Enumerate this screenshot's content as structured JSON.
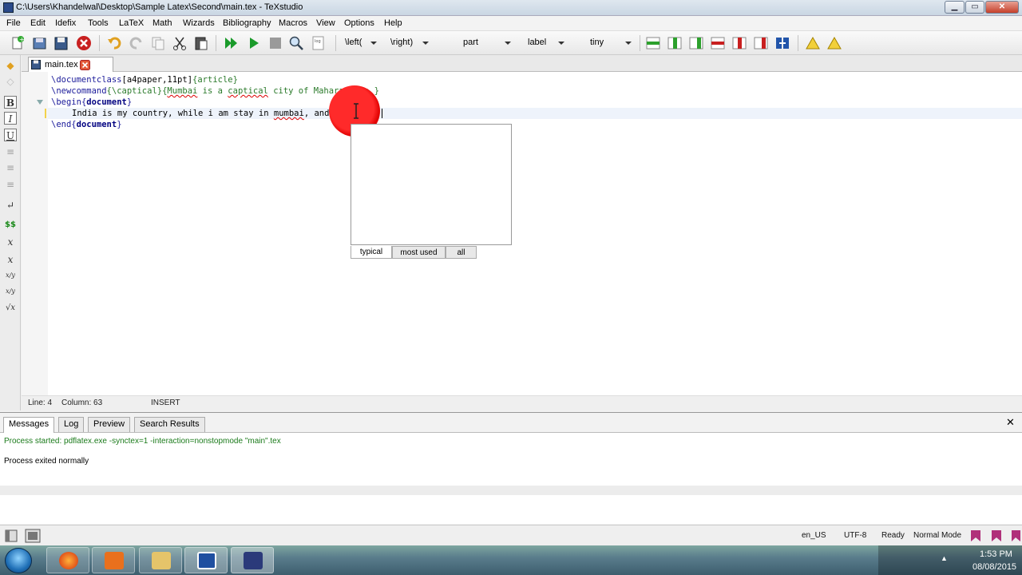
{
  "window": {
    "title": "C:\\Users\\Khandelwal\\Desktop\\Sample Latex\\Second\\main.tex - TeXstudio",
    "buttons": {
      "minimize": "▁",
      "maximize": "▭",
      "close": "✕"
    }
  },
  "menu": {
    "items": [
      "File",
      "Edit",
      "Idefix",
      "Tools",
      "LaTeX",
      "Math",
      "Wizards",
      "Bibliography",
      "Macros",
      "View",
      "Options",
      "Help"
    ]
  },
  "toolbar": {
    "combos": [
      {
        "label": "\\left("
      },
      {
        "label": "\\right)"
      },
      {
        "label": "part"
      },
      {
        "label": "label"
      },
      {
        "label": "tiny"
      }
    ],
    "icons": [
      "new-file-icon",
      "save-all-icon",
      "save-icon",
      "close-file-icon",
      "undo-icon",
      "redo-icon",
      "copy-icon",
      "cut-icon",
      "paste-icon",
      "build-and-view-icon",
      "compile-icon",
      "stop-icon",
      "view-pdf-icon",
      "view-log-icon"
    ]
  },
  "sidebar": {
    "items": [
      {
        "name": "bookmark-icon",
        "glyph": "◆"
      },
      {
        "name": "home-icon",
        "glyph": "◇"
      },
      {
        "name": "bold-icon",
        "glyph": "B"
      },
      {
        "name": "italic-icon",
        "glyph": "I"
      },
      {
        "name": "underline-icon",
        "glyph": "U"
      },
      {
        "name": "align-left-icon",
        "glyph": "≡"
      },
      {
        "name": "align-center-icon",
        "glyph": "≡"
      },
      {
        "name": "align-right-icon",
        "glyph": "≡"
      },
      {
        "name": "newline-icon",
        "glyph": "↵"
      },
      {
        "name": "math-mode-icon",
        "glyph": "$$"
      },
      {
        "name": "subscript-icon",
        "glyph": "x"
      },
      {
        "name": "superscript-icon",
        "glyph": "x"
      },
      {
        "name": "fraction-icon",
        "glyph": "x/y"
      },
      {
        "name": "dfrac-icon",
        "glyph": "x/y"
      },
      {
        "name": "sqrt-icon",
        "glyph": "√x"
      }
    ]
  },
  "editor": {
    "tab_label": "main.tex",
    "lines": {
      "l1_cmd": "\\documentclass",
      "l1_opt": "[a4paper,11pt]",
      "l1_arg": "{article}",
      "l2_cmd": "\\newcommand",
      "l2_arg1": "{\\captical}",
      "l2_open": "{",
      "l2_w1": "Mumbai",
      "l2_mid": " is a ",
      "l2_w2": "captical",
      "l2_rest": " city of Maharashtra }",
      "l3_cmd": "\\begin",
      "l3_open": "{",
      "l3_env": "document",
      "l3_close": "}",
      "l4_text1": "India is my country, while i am stay in ",
      "l4_w1": "mumbai",
      "l4_text2": ", and \\captical",
      "l5_cmd": "\\end",
      "l5_open": "{",
      "l5_env": "document",
      "l5_close": "}"
    }
  },
  "completer": {
    "tabs": [
      "typical",
      "most used",
      "all"
    ]
  },
  "status": {
    "line": "Line: 4",
    "column": "Column: 63",
    "mode": "INSERT"
  },
  "messages": {
    "tabs": [
      "Messages",
      "Log",
      "Preview",
      "Search Results"
    ],
    "close": "✕",
    "line1": "Process started: pdflatex.exe -synctex=1 -interaction=nonstopmode \"main\".tex",
    "line2": "Process exited normally"
  },
  "bottom": {
    "language": "en_US",
    "encoding": "UTF-8",
    "state": "Ready",
    "mode": "Normal Mode"
  },
  "taskbar": {
    "time": "1:53 PM",
    "date": "08/08/2015",
    "tray_arrow": "▲"
  },
  "colors": {
    "keyword": "#1a1a9a",
    "bracket_arg": "#2a7a2a",
    "message_green": "#1a7a1a",
    "highlight_red": "#ff2a2a"
  }
}
